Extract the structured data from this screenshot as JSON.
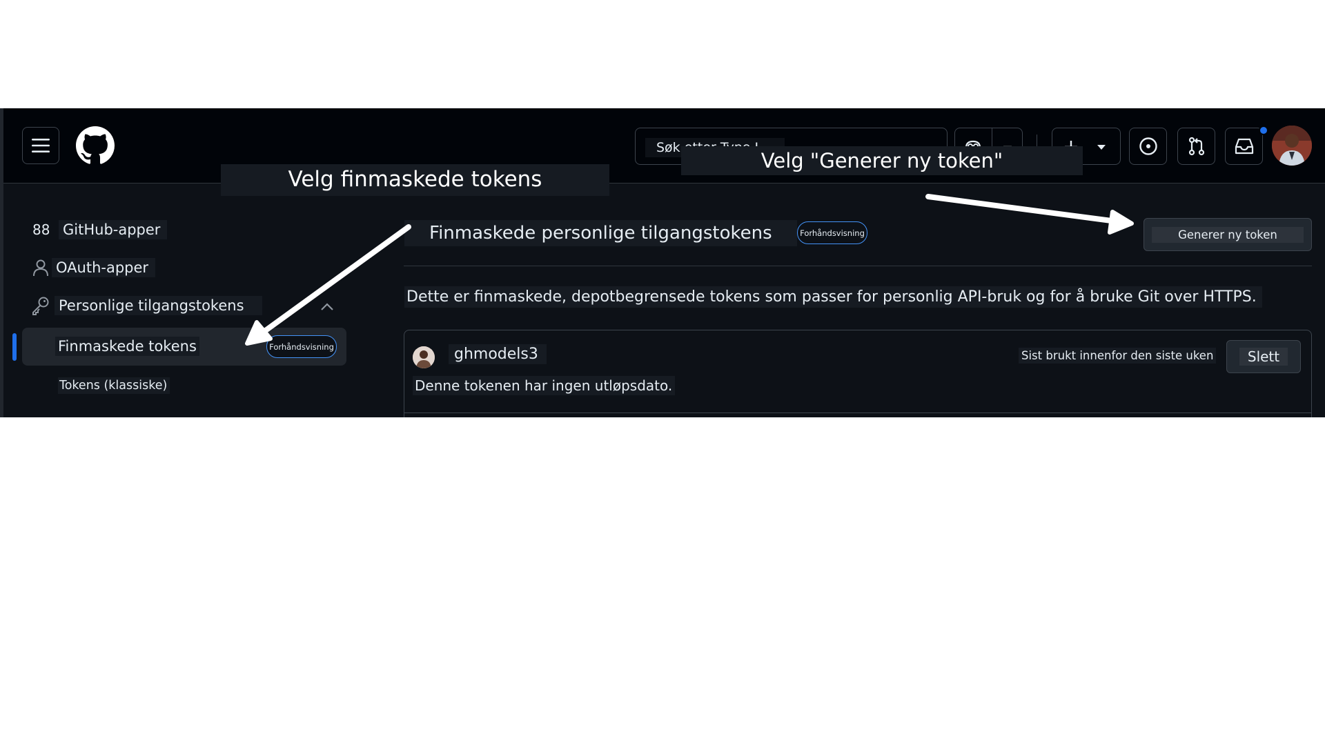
{
  "header": {
    "search_text": "Søk etter Type I",
    "menu_icon": "hamburger-icon",
    "logo_icon": "github-logo-icon",
    "copilot_icon": "copilot-icon",
    "create_icon": "plus-icon",
    "issues_icon": "issue-opened-icon",
    "pulls_icon": "git-pull-request-icon",
    "inbox_icon": "inbox-icon",
    "notification_color": "#1f6feb"
  },
  "callouts": {
    "fine_grained": "Velg finmaskede tokens",
    "generate": "Velg \"Generer ny token\""
  },
  "sidebar": {
    "github_apps_glyph": "88",
    "github_apps": "GitHub-apper",
    "oauth_apps": "OAuth-apper",
    "personal_tokens": "Personlige tilgangstokens",
    "fine_grained": "Finmaskede tokens",
    "fine_grained_badge": "Forhåndsvisning",
    "classic": "Tokens (klassiske)"
  },
  "main": {
    "title": "Finmaskede personlige tilgangstokens",
    "title_badge": "Forhåndsvisning",
    "generate_button": "Generer ny token",
    "description": "Dette er finmaskede, depotbegrensede tokens som passer for personlig API-bruk og for å bruke Git over HTTPS.",
    "token": {
      "name": "ghmodels3",
      "expiry": "Denne tokenen har ingen utløpsdato.",
      "last_used": "Sist brukt innenfor den siste uken",
      "delete_button": "Slett"
    }
  },
  "colors": {
    "header_bg": "#010409",
    "page_bg": "#0d1117",
    "accent": "#1f6feb",
    "badge_border": "#4493f8"
  }
}
